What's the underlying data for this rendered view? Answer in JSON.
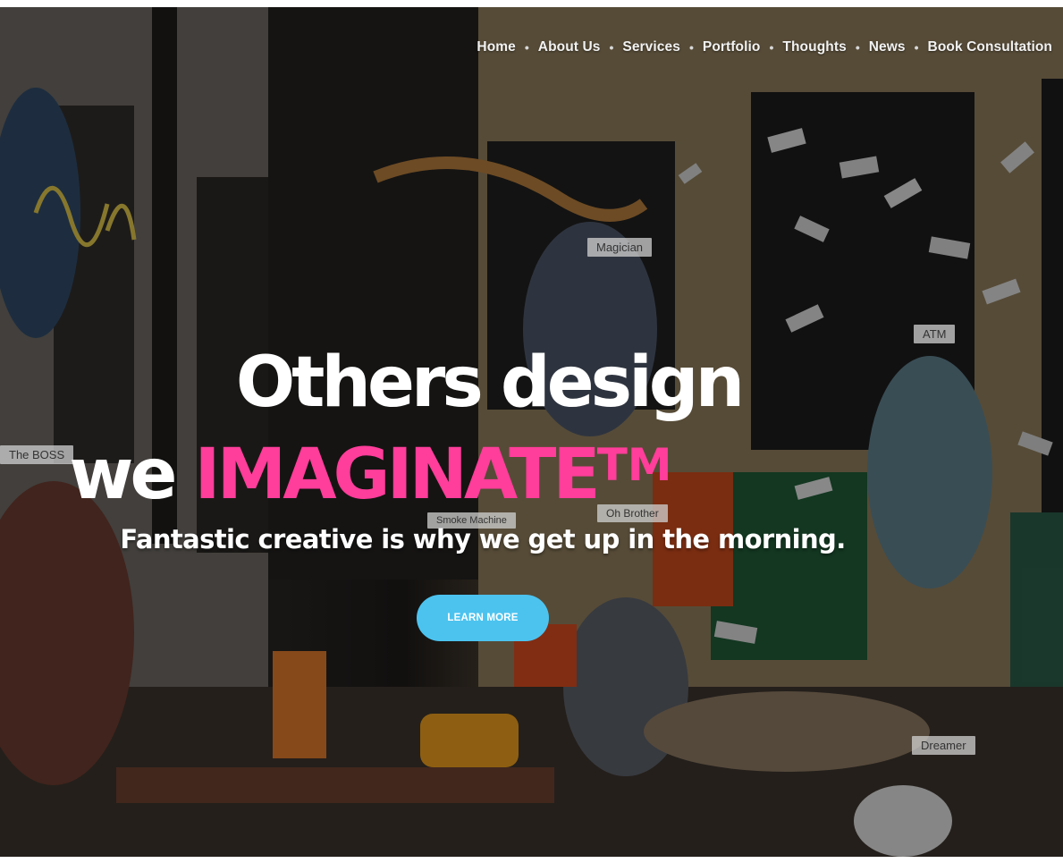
{
  "nav": {
    "items": [
      {
        "label": "Home"
      },
      {
        "label": "About Us"
      },
      {
        "label": "Services"
      },
      {
        "label": "Portfolio"
      },
      {
        "label": "Thoughts"
      },
      {
        "label": "News"
      },
      {
        "label": "Book Consultation"
      }
    ],
    "separator": "•"
  },
  "hero": {
    "line1": "Others design",
    "line2_prefix": "we ",
    "line2_accent": "IMAGINATE",
    "line2_tm": "TM",
    "subtitle": "Fantastic creative is why we get up in the morning.",
    "cta_label": "LEARN MORE"
  },
  "photo_tags": {
    "magician": "Magician",
    "atm": "ATM",
    "boss": "The BOSS",
    "smoke": "Smoke Machine",
    "brother": "Oh Brother",
    "dreamer": "Dreamer"
  },
  "colors": {
    "accent_pink": "#ff3d9a",
    "cta_blue": "#4cc3ef"
  }
}
